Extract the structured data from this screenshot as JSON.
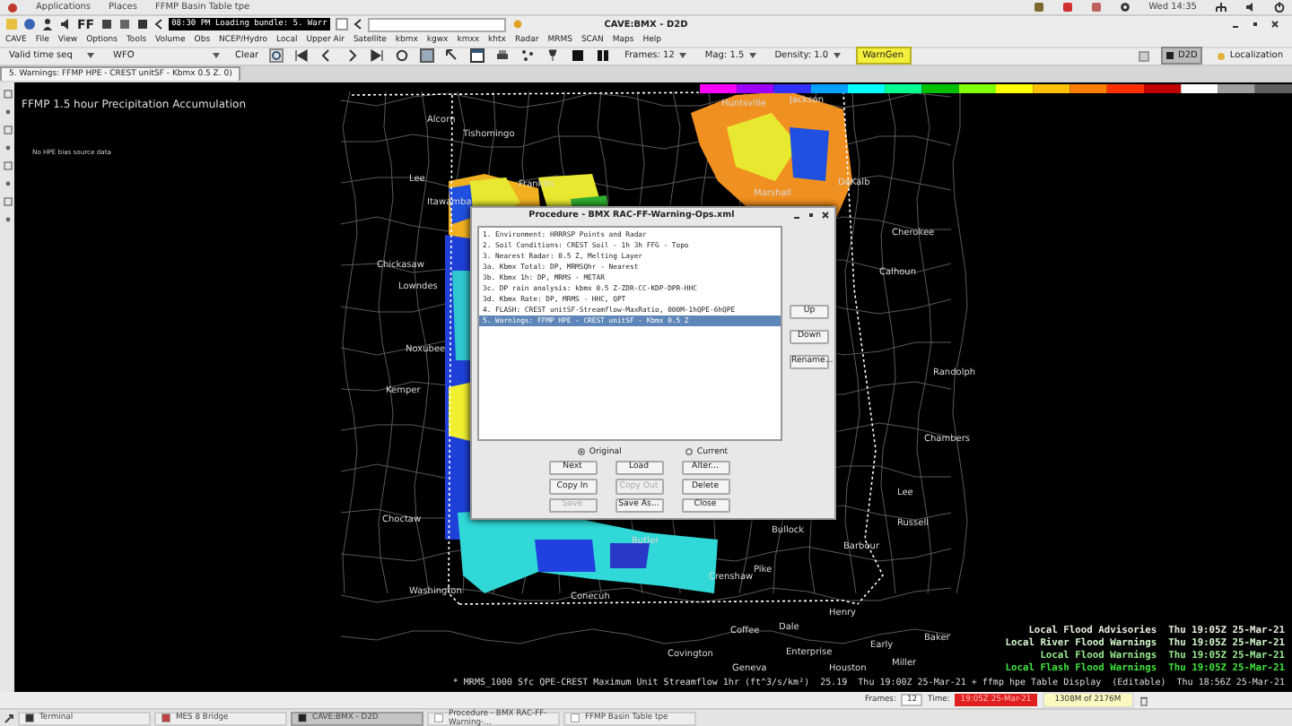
{
  "top_bar": {
    "menus": [
      "Applications",
      "Places",
      "FFMP Basin Table tpe"
    ],
    "clock": "Wed 14:35"
  },
  "window": {
    "title": "CAVE:BMX - D2D",
    "ff_label": "FF",
    "loading_text": "08:30 PM Loading bundle: 5. Warr"
  },
  "menu_bar": [
    "CAVE",
    "File",
    "View",
    "Options",
    "Tools",
    "Volume",
    "Obs",
    "NCEP/Hydro",
    "Local",
    "Upper Air",
    "Satellite",
    "kbmx",
    "kgwx",
    "kmxx",
    "khtx",
    "Radar",
    "MRMS",
    "SCAN",
    "Maps",
    "Help"
  ],
  "toolbar": {
    "time_seq": "Valid time seq",
    "scale": "WFO",
    "clear": "Clear",
    "frames": "Frames: 12",
    "mag": "Mag: 1.5",
    "density": "Density: 1.0",
    "warngen": "WarnGen",
    "perspective": "D2D",
    "localization": "Localization"
  },
  "tab": {
    "label": "5. Warnings: FFMP HPE - CREST unitSF - Kbmx 0.5 Z. 0)"
  },
  "map": {
    "title": "FFMP 1.5 hour Precipitation Accumulation",
    "note": "No HPE bias source data",
    "place_labels": [
      "Alcorn",
      "Tishomingo",
      "Huntsville",
      "Jackson",
      "Franklin",
      "Marshall",
      "DeKalb",
      "Cherokee",
      "Lee",
      "Itawamba",
      "Chickasaw",
      "Calhoun",
      "Lowndes",
      "Noxubee",
      "Kemper",
      "Randolph",
      "Chambers",
      "Choctaw",
      "Lee",
      "Russell",
      "Bullock",
      "Butler",
      "Pike",
      "Barbour",
      "Crenshaw",
      "Washington",
      "Conecuh",
      "Coffee",
      "Dale",
      "Henry",
      "Covington",
      "Enterprise",
      "Houston",
      "Miller",
      "Baker",
      "Early",
      "Geneva"
    ],
    "legend": [
      {
        "text": "Local Flood Advisories  Thu 19:05Z 25-Mar-21",
        "color": "#e6efe0"
      },
      {
        "text": "Local River Flood Warnings  Thu 19:05Z 25-Mar-21",
        "color": "#d2f7cc"
      },
      {
        "text": "Local Flood Warnings  Thu 19:05Z 25-Mar-21",
        "color": "#9beb93"
      },
      {
        "text": "Local Flash Flood Warnings  Thu 19:05Z 25-Mar-21",
        "color": "#3fe33a"
      }
    ],
    "footer": "* MRMS_1000 Sfc QPE-CREST Maximum Unit Streamflow 1hr (ft^3/s/km²)  25.19  Thu 19:00Z 25-Mar-21 + ffmp hpe Table Display  (Editable)  Thu 18:56Z 25-Mar-21"
  },
  "dialog": {
    "title": "Procedure - BMX RAC-FF-Warning-Ops.xml",
    "items": [
      {
        "text": "1. Environment: HRRRSP Points and Radar",
        "selected": false
      },
      {
        "text": "2. Soil Conditions: CREST Soil - 1h 3h FFG - Topo",
        "selected": false
      },
      {
        "text": "3. Nearest Radar: 0.5 Z, Melting Layer",
        "selected": false
      },
      {
        "text": "3a. Kbmx Total: DP, MRMSQhr - Nearest",
        "selected": false
      },
      {
        "text": "3b. Kbmx 1h: DP, MRMS - METAR",
        "selected": false
      },
      {
        "text": "3c. DP rain analysis: kbmx 0.5 Z-ZDR-CC-KDP-DPR-HHC",
        "selected": false
      },
      {
        "text": "3d. Kbmx Rate: DP, MRMS - HHC, QPT",
        "selected": false
      },
      {
        "text": "4. FLASH: CREST unitSF-Streamflow-MaxRatio, 000M-1hQPE-6hQPE",
        "selected": false
      },
      {
        "text": "5. Warnings: FFMP HPE - CREST unitSF - Kbmx 0.5 Z",
        "selected": true
      }
    ],
    "side_buttons": [
      "Up",
      "Down",
      "Rename..."
    ],
    "radios": [
      {
        "label": "Original",
        "selected": true
      },
      {
        "label": "Current",
        "selected": false
      }
    ],
    "buttons": [
      {
        "label": "Next",
        "disabled": false
      },
      {
        "label": "Load",
        "disabled": false
      },
      {
        "label": "Alter...",
        "disabled": false
      },
      {
        "label": "Copy In",
        "disabled": false
      },
      {
        "label": "Copy Out",
        "disabled": true
      },
      {
        "label": "Delete",
        "disabled": false
      },
      {
        "label": "Save",
        "disabled": true
      },
      {
        "label": "Save As...",
        "disabled": false
      },
      {
        "label": "Close",
        "disabled": false
      }
    ]
  },
  "status": {
    "frames_label": "Frames:",
    "frames": "12",
    "time_label": "Time:",
    "time": "19:05Z 25-Mar-21",
    "memory": "1308M of 2176M"
  },
  "taskbar": [
    {
      "label": "Terminal",
      "selected": false
    },
    {
      "label": "MES 8 Bridge",
      "selected": false
    },
    {
      "label": "CAVE:BMX - D2D",
      "selected": true
    },
    {
      "label": "Procedure - BMX RAC-FF-Warning-...",
      "selected": false
    },
    {
      "label": "FFMP Basin Table tpe",
      "selected": false
    }
  ]
}
